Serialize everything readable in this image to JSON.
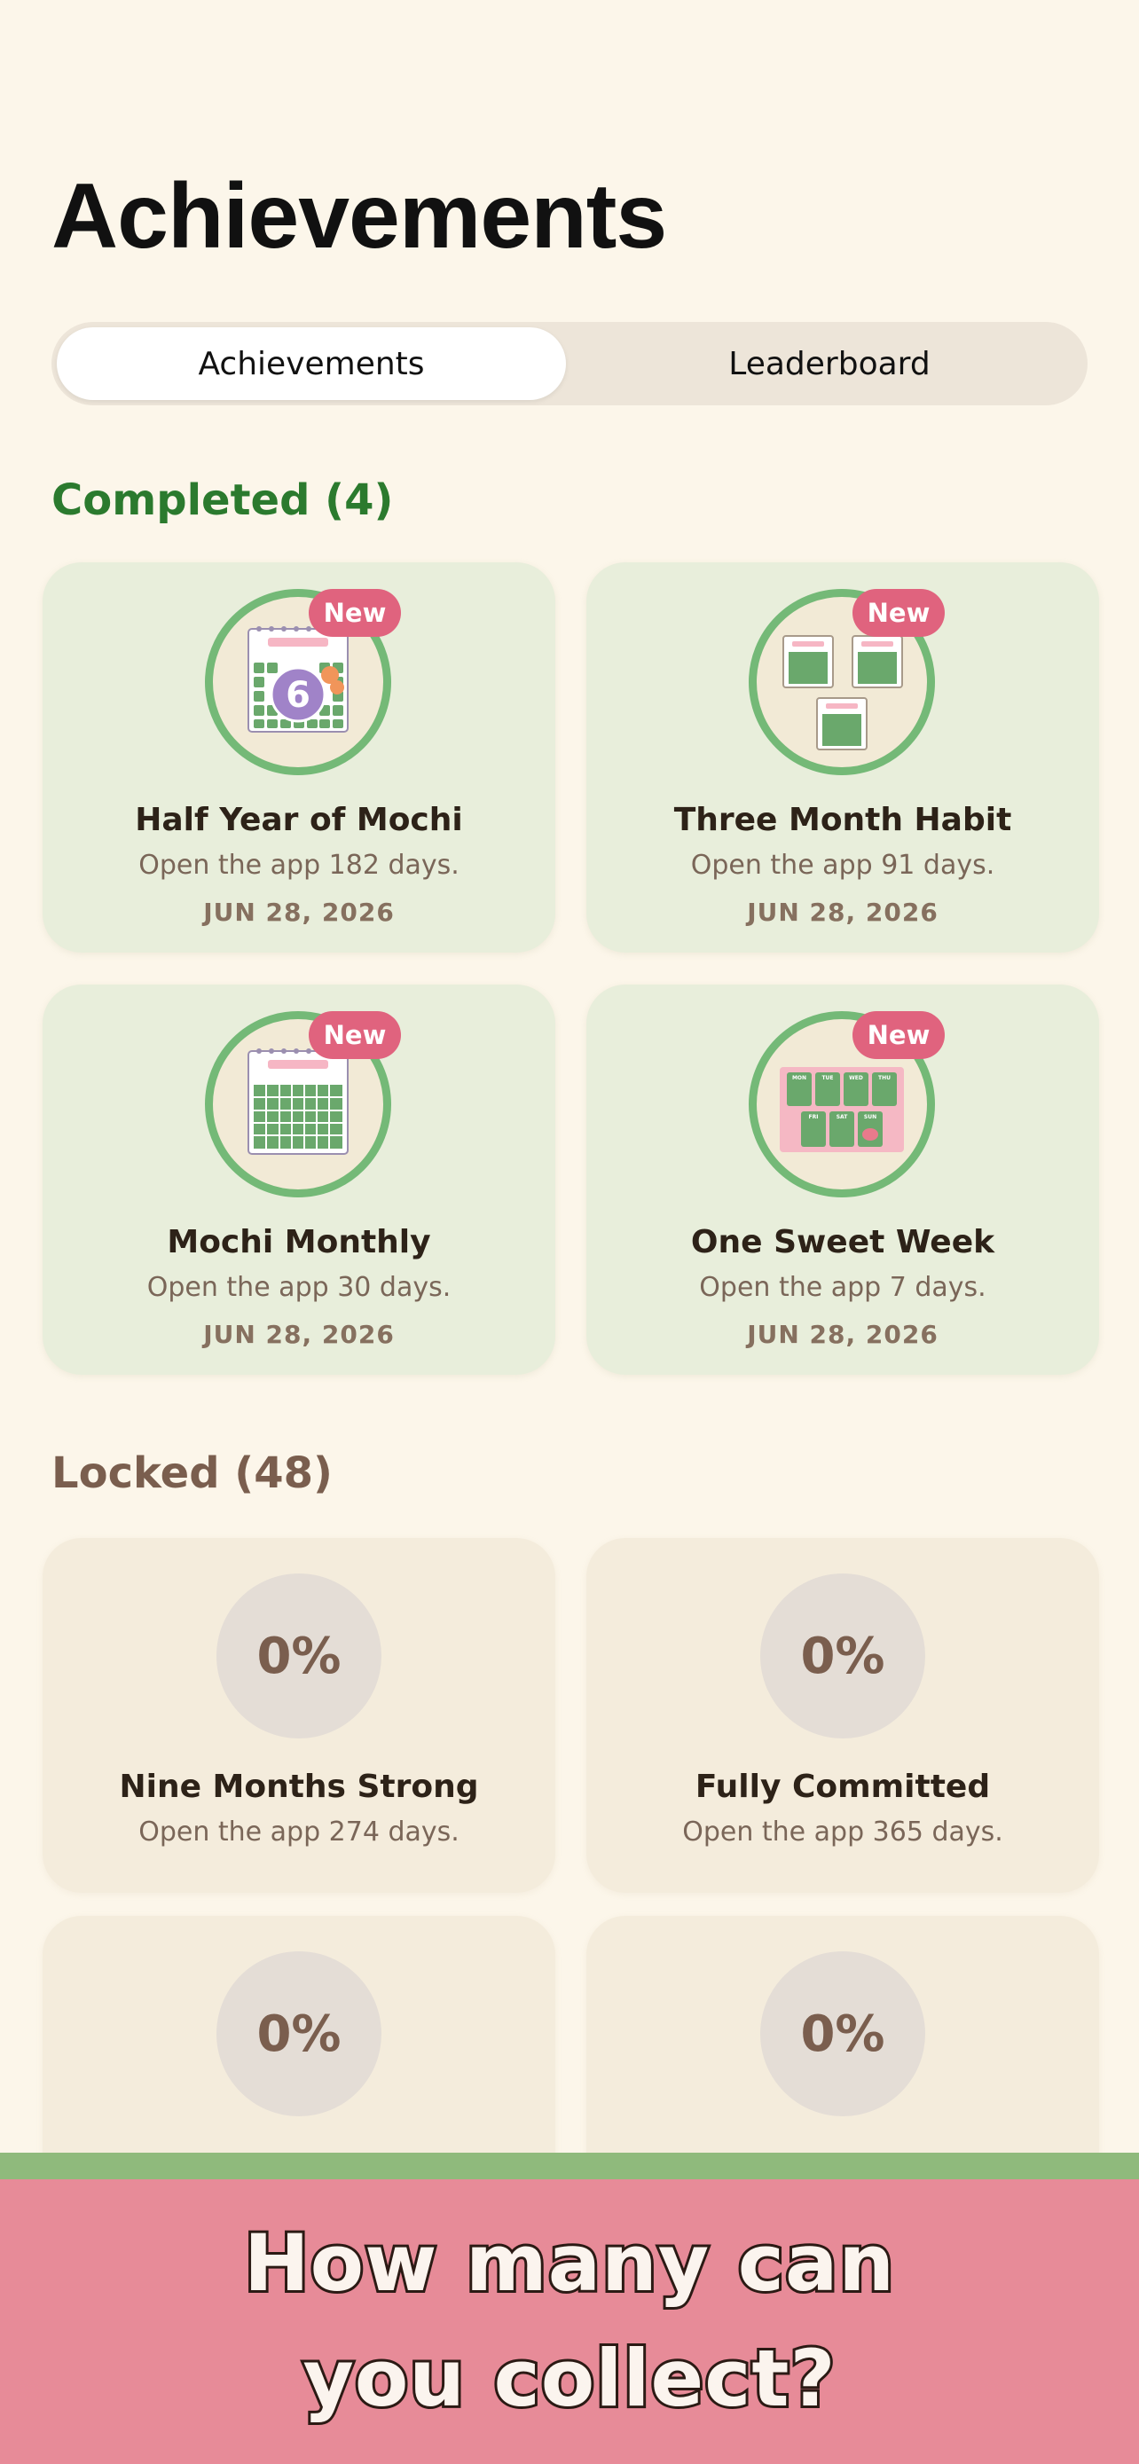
{
  "header": {
    "title": "Achievements"
  },
  "tabs": [
    {
      "label": "Achievements",
      "active": true
    },
    {
      "label": "Leaderboard",
      "active": false
    }
  ],
  "completed": {
    "title": "Completed (4)",
    "items": [
      {
        "name": "Half Year of Mochi",
        "desc": "Open the app 182 days.",
        "date": "JUN 28, 2026",
        "badge": "New",
        "icon": "calendar-six-months-icon",
        "calendar_number": "6"
      },
      {
        "name": "Three Month Habit",
        "desc": "Open the app 91 days.",
        "date": "JUN 28, 2026",
        "badge": "New",
        "icon": "three-calendars-icon"
      },
      {
        "name": "Mochi Monthly",
        "desc": "Open the app 30 days.",
        "date": "JUN 28, 2026",
        "badge": "New",
        "icon": "monthly-calendar-icon"
      },
      {
        "name": "One Sweet Week",
        "desc": "Open the app 7 days.",
        "date": "JUN 28, 2026",
        "badge": "New",
        "icon": "weekly-calendar-icon",
        "weekdays": [
          "MON",
          "TUE",
          "WED",
          "THU",
          "FRI",
          "SAT",
          "SUN"
        ]
      }
    ]
  },
  "locked": {
    "title": "Locked (48)",
    "items": [
      {
        "name": "Nine Months Strong",
        "desc": "Open the app 274 days.",
        "progress": "0%"
      },
      {
        "name": "Fully Committed",
        "desc": "Open the app 365 days.",
        "progress": "0%"
      },
      {
        "name": "",
        "desc": "",
        "progress": "0%"
      },
      {
        "name": "",
        "desc": "",
        "progress": "0%"
      }
    ]
  },
  "promo": {
    "line1": "How many can",
    "line2": "you collect?"
  },
  "colors": {
    "accent_green": "#2b7a2e",
    "badge_pink": "#e0637e",
    "banner_pink": "#e78b98",
    "banner_green": "#8fba7c",
    "background": "#fcf6ea"
  }
}
